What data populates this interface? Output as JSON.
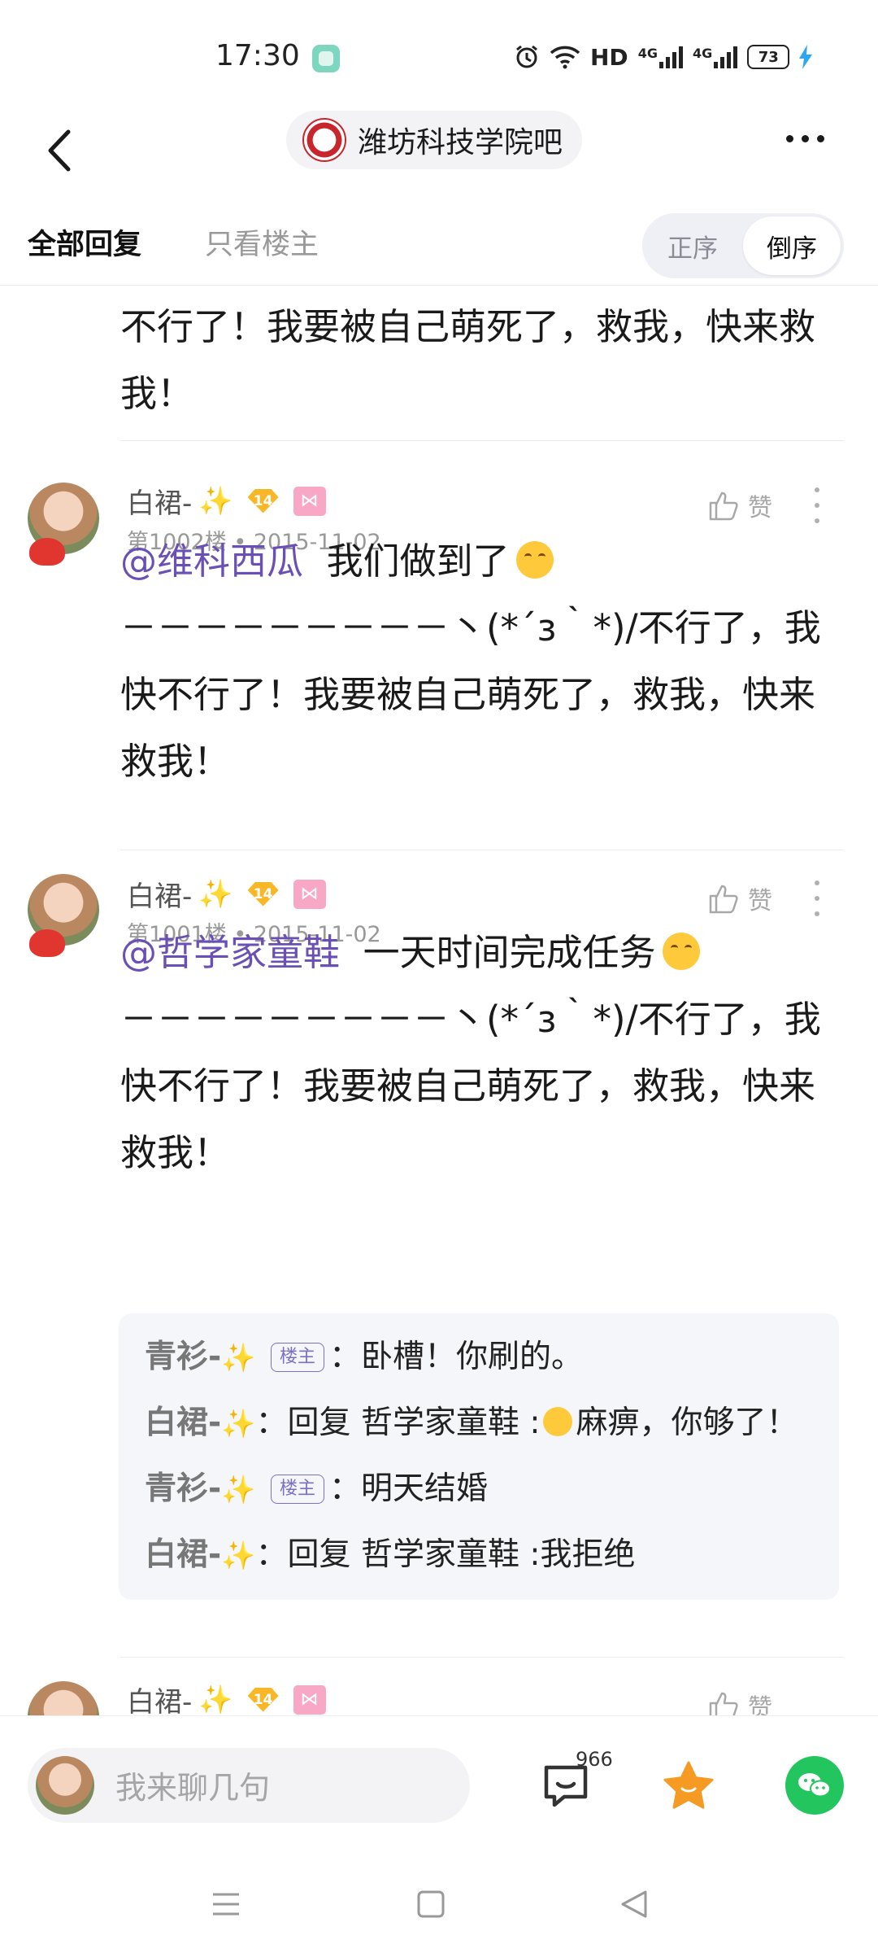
{
  "status_bar": {
    "time": "17:30",
    "network_label": "HD",
    "net1": "4G",
    "net2": "4G",
    "battery": "73"
  },
  "nav": {
    "forum_name": "潍坊科技学院吧"
  },
  "tabs": {
    "all_label": "全部回复",
    "host_only_label": "只看楼主",
    "sort_asc_label": "正序",
    "sort_desc_label": "倒序"
  },
  "posts": {
    "prev_tail": {
      "body": "不行了！我要被自己萌死了，救我，快来救我！"
    },
    "p1": {
      "username": "白裙-",
      "level": "14",
      "floor": "第1002楼",
      "date": "2015-11-02",
      "like_label": "赞",
      "mention": "@维科西瓜",
      "text": "我们做到了",
      "body": "－－－－－－－－－丶(*´з｀*)/不行了，我快不行了！我要被自己萌死了，救我，快来救我！"
    },
    "p2": {
      "username": "白裙-",
      "level": "14",
      "floor": "第1001楼",
      "date": "2015-11-02",
      "like_label": "赞",
      "mention": "@哲学家童鞋",
      "text": "一天时间完成任务",
      "body": "－－－－－－－－－丶(*´з｀*)/不行了，我快不行了！我要被自己萌死了，救我，快来救我！",
      "replies": [
        {
          "name": "青衫-",
          "host_tag": "楼主",
          "sep": "：",
          "text": "卧槽！你刷的。"
        },
        {
          "name": "白裙-",
          "sep": "：",
          "prefix": "回复 哲学家童鞋 :",
          "text": "麻痹，你够了！"
        },
        {
          "name": "青衫-",
          "host_tag": "楼主",
          "sep": "：",
          "text": "明天结婚"
        },
        {
          "name": "白裙-",
          "sep": "：",
          "prefix": "回复 哲学家童鞋 :",
          "text": "我拒绝"
        }
      ]
    },
    "p3": {
      "username": "白裙-",
      "level": "14",
      "like_label": "赞"
    }
  },
  "bottom": {
    "input_placeholder": "我来聊几句",
    "comment_count": "966"
  },
  "colors": {
    "mention": "#6a4fb5",
    "wechat": "#22c55e",
    "star": "#f59a23"
  }
}
